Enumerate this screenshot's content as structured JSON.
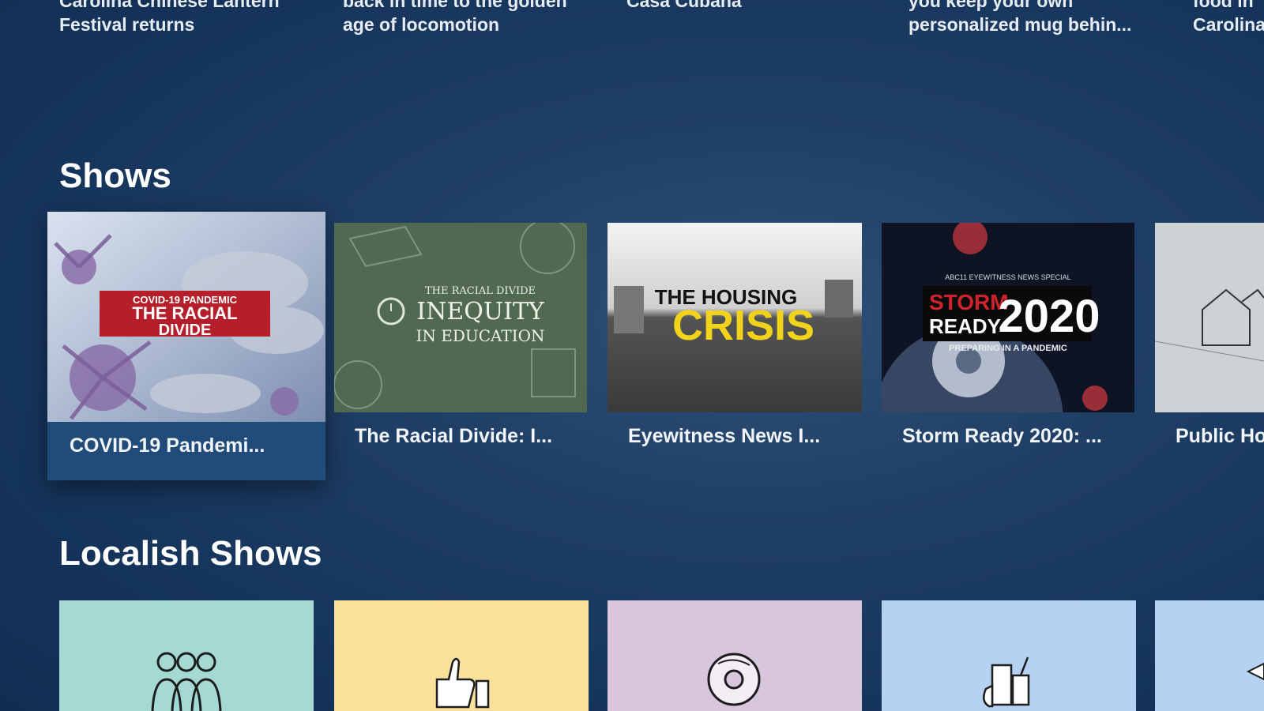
{
  "top_row": {
    "items": [
      {
        "line1": "Carolina Chinese Lantern",
        "line2": "Festival returns"
      },
      {
        "line1": "back in time to the golden",
        "line2": "age of locomotion"
      },
      {
        "line1": "Casa Cubana",
        "line2": ""
      },
      {
        "line1": "you keep your own",
        "line2": "personalized mug behin..."
      },
      {
        "line1": "food in",
        "line2": "Carolina"
      }
    ]
  },
  "shows": {
    "title": "Shows",
    "cards": [
      {
        "label": "COVID-19 Pandemi...",
        "art": {
          "line1": "COVID-19 PANDEMIC",
          "line2": "THE RACIAL",
          "line3": "DIVIDE"
        }
      },
      {
        "label": "The Racial Divide: I...",
        "art": {
          "line1": "THE RACIAL DIVIDE",
          "line2": "INEQUITY",
          "line3": "IN EDUCATION"
        }
      },
      {
        "label": "Eyewitness News I...",
        "art": {
          "line1": "THE HOUSING",
          "line2": "CRISIS"
        }
      },
      {
        "label": "Storm Ready 2020: ...",
        "art": {
          "line1": "ABC11 EYEWITNESS NEWS SPECIAL",
          "line2": "STORM",
          "line3": "READY",
          "line4": "2020",
          "line5": "PREPARING IN A PANDEMIC"
        }
      },
      {
        "label": "Public Ho",
        "art": {}
      }
    ]
  },
  "localish": {
    "title": "Localish Shows",
    "tiles": [
      {
        "icon": "people-group-icon",
        "color": "#a4d9d4"
      },
      {
        "icon": "thumbs-up-icon",
        "color": "#f7e19b"
      },
      {
        "icon": "donut-icon",
        "color": "#d7c6dc"
      },
      {
        "icon": "drinks-icon",
        "color": "#b5d2f3"
      },
      {
        "icon": "partial-icon",
        "color": "#b5d2f3"
      }
    ]
  }
}
